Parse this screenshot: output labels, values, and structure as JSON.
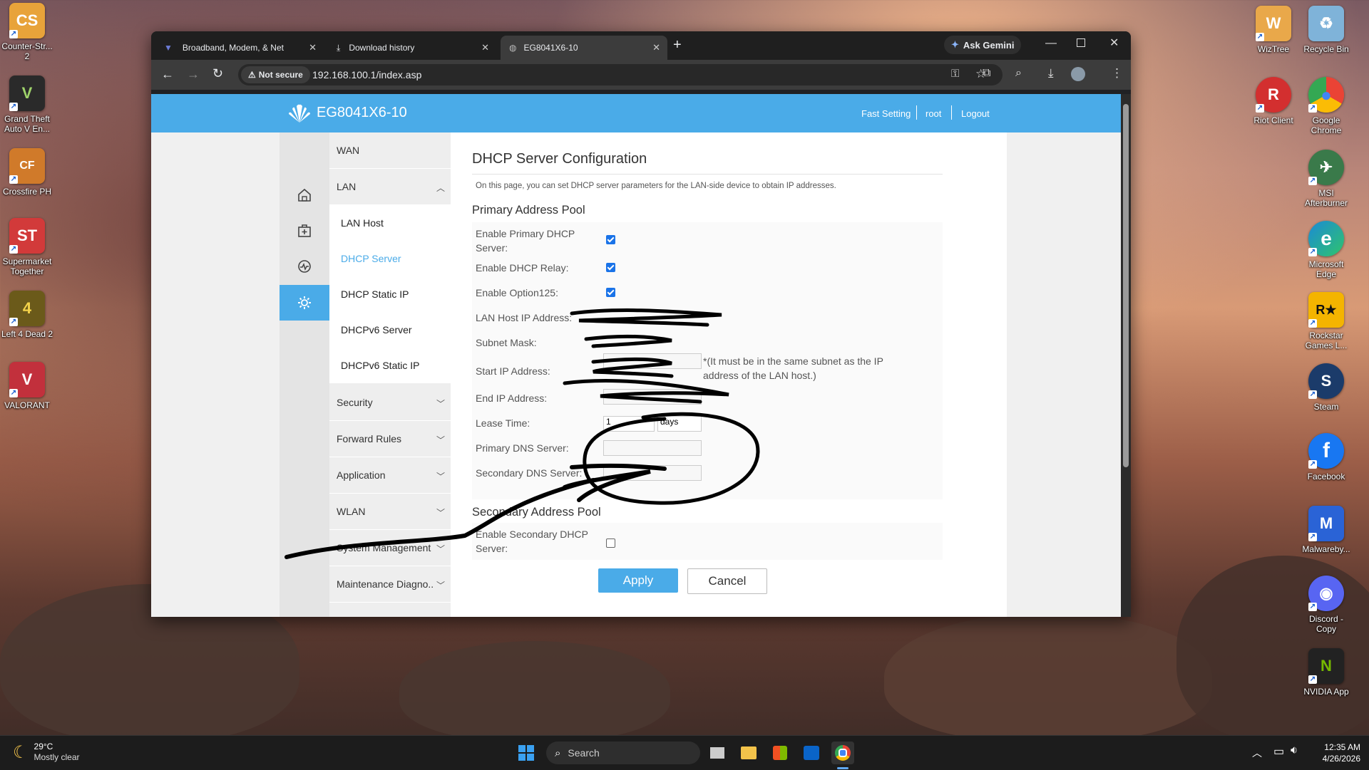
{
  "desktop_left": [
    {
      "label": "Counter-Str... 2",
      "color": "#e8a33a",
      "glyph": "CS"
    },
    {
      "label": "Grand Theft Auto V En...",
      "color": "#2a2a2a",
      "glyph": "V"
    },
    {
      "label": "Crossfire PH",
      "color": "#d07a2a",
      "glyph": "CF"
    },
    {
      "label": "Supermarket Together",
      "color": "#d23a3a",
      "glyph": "ST"
    },
    {
      "label": "Left 4 Dead 2",
      "color": "#6b5a1a",
      "glyph": "4"
    },
    {
      "label": "VALORANT",
      "color": "#c2303c",
      "glyph": "V"
    }
  ],
  "desktop_right": [
    {
      "label": "WizTree",
      "color": "#e9a84a",
      "glyph": "W"
    },
    {
      "label": "Recycle Bin",
      "color": "#7fb3d9",
      "glyph": "♻"
    },
    {
      "label": "Riot Client",
      "color": "#d32f2f",
      "glyph": "R"
    },
    {
      "label": "Google Chrome",
      "color": "#34a853",
      "glyph": "●"
    },
    {
      "label": "MSI Afterburner",
      "color": "#3a7a4a",
      "glyph": "✈"
    },
    {
      "label": "Microsoft Edge",
      "color": "#1b8ad6",
      "glyph": "e"
    },
    {
      "label": "Rockstar Games L...",
      "color": "#f4b400",
      "glyph": "R★"
    },
    {
      "label": "Steam",
      "color": "#1b3b6a",
      "glyph": "S"
    },
    {
      "label": "Facebook",
      "color": "#1877f2",
      "glyph": "f"
    },
    {
      "label": "Malwareby...",
      "color": "#2a63d6",
      "glyph": "M"
    },
    {
      "label": "Discord - Copy",
      "color": "#5865f2",
      "glyph": "◉"
    },
    {
      "label": "NVIDIA App",
      "color": "#76b900",
      "glyph": "N"
    }
  ],
  "browser": {
    "tabs": [
      {
        "title": "Broadband, Modem, & Net"
      },
      {
        "title": "Download history"
      },
      {
        "title": "EG8041X6-10"
      }
    ],
    "new_tab": "+",
    "ask_gemini": "Ask Gemini",
    "security_chip": "Not secure",
    "url": "192.168.100.1/index.asp"
  },
  "router": {
    "model": "EG8041X6-10",
    "header_links": {
      "fast_setting": "Fast Setting",
      "user": "root",
      "logout": "Logout"
    },
    "menu": [
      {
        "label": "WAN"
      },
      {
        "label": "LAN"
      },
      {
        "label": "Security"
      },
      {
        "label": "Forward Rules"
      },
      {
        "label": "Application"
      },
      {
        "label": "WLAN"
      },
      {
        "label": "System Management"
      },
      {
        "label": "Maintenance Diagno.."
      }
    ],
    "lan_submenu": [
      {
        "label": "LAN Host"
      },
      {
        "label": "DHCP Server"
      },
      {
        "label": "DHCP Static IP"
      },
      {
        "label": "DHCPv6 Server"
      },
      {
        "label": "DHCPv6 Static IP"
      }
    ],
    "page_title": "DHCP Server Configuration",
    "intro": "On this page, you can set DHCP server parameters for the LAN-side device to obtain IP addresses.",
    "primary_pool": "Primary Address Pool",
    "fields": {
      "enable_primary": "Enable Primary DHCP Server:",
      "enable_relay": "Enable DHCP Relay:",
      "enable_option125": "Enable Option125:",
      "lan_host_ip": "LAN Host IP Address:",
      "subnet_mask": "Subnet Mask:",
      "start_ip": "Start IP Address:",
      "start_ip_note": "*(It must be in the same subnet as the IP address of the LAN host.)",
      "end_ip": "End IP Address:",
      "lease_time": "Lease Time:",
      "lease_value": "1",
      "lease_unit": "days",
      "primary_dns": "Primary DNS Server:",
      "secondary_dns": "Secondary DNS Server:"
    },
    "secondary_pool": "Secondary Address Pool",
    "enable_secondary": "Enable Secondary DHCP Server:",
    "apply": "Apply",
    "cancel": "Cancel"
  },
  "taskbar": {
    "temp": "29°C",
    "weather": "Mostly clear",
    "search": "Search",
    "time": "12:35 AM",
    "date": "4/26/2026"
  },
  "colors": {
    "router_blue": "#4aabe8",
    "accent": "#1a73e8",
    "active_menu": "#4aabe8"
  }
}
